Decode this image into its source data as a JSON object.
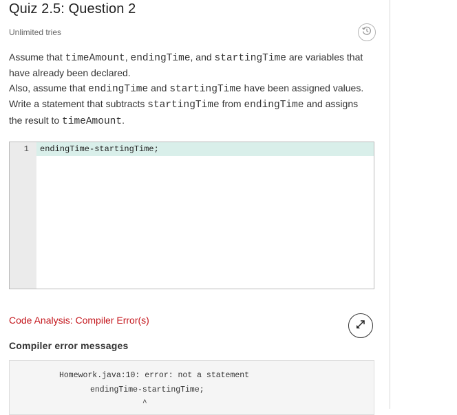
{
  "quiz": {
    "title": "Quiz 2.5: Question 2",
    "tries": "Unlimited tries"
  },
  "icons": {
    "history": "history-icon",
    "expand": "expand-arrows-icon"
  },
  "prompt": {
    "p1": {
      "t1": "Assume that ",
      "c1": "timeAmount",
      "t2": ", ",
      "c2": "endingTime",
      "t3": ", and ",
      "c3": "startingTime",
      "t4": " are variables that have already been declared."
    },
    "p2": {
      "t1": "Also, assume that ",
      "c1": "endingTime",
      "t2": " and ",
      "c2": "startingTime",
      "t3": " have been assigned values."
    },
    "p3": {
      "t1": "Write a statement that subtracts ",
      "c1": "startingTime",
      "t2": " from ",
      "c2": "endingTime",
      "t3": " and assigns the result to ",
      "c3": "timeAmount",
      "t4": "."
    }
  },
  "editor": {
    "lines": [
      {
        "number": "1",
        "text": "endingTime-startingTime;"
      }
    ]
  },
  "analysis": {
    "title": "Code Analysis: Compiler Error(s)",
    "heading": "Compiler error messages",
    "errors": [
      "Homework.java:10: error: not a statement",
      "endingTime-startingTime;"
    ],
    "caret": "^"
  },
  "colors": {
    "error_red": "#c4161c",
    "active_line": "#d9efea",
    "gutter": "#ebebeb"
  }
}
